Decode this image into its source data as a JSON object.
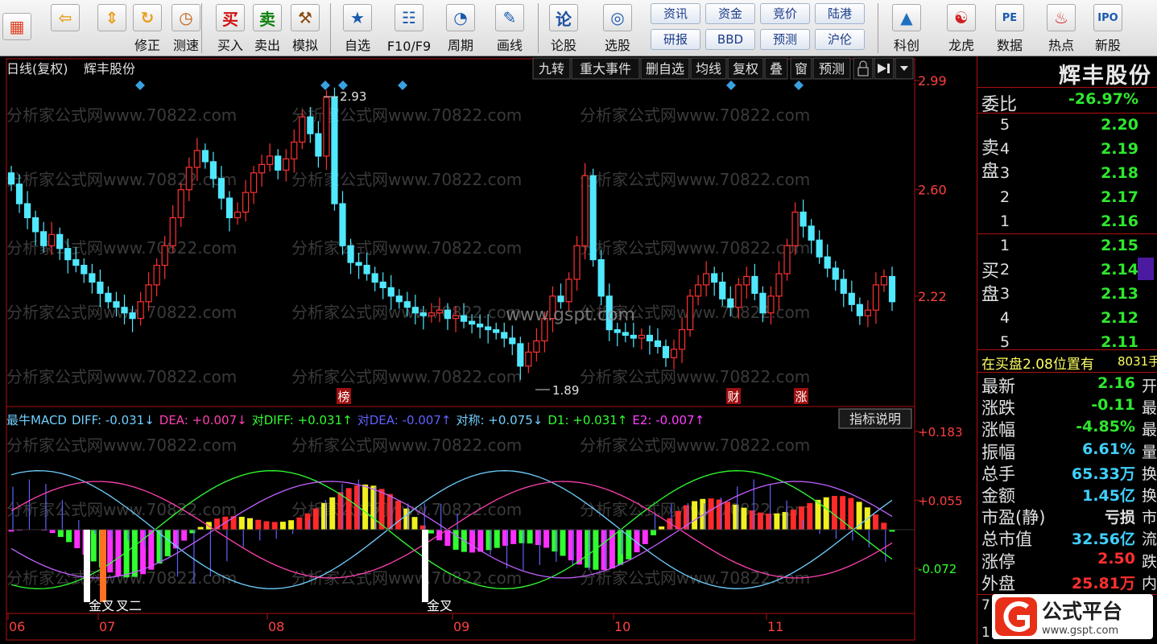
{
  "toolbar": {
    "buttons": [
      {
        "label": "",
        "icon": "app-grid-icon"
      },
      {
        "label": "",
        "icon": "back-arrow-icon"
      },
      {
        "label": "",
        "icon": "up-down-arrows-icon"
      },
      {
        "label": "修正",
        "icon": "refresh-icon"
      },
      {
        "label": "测速",
        "icon": "clock-icon"
      },
      {
        "label": "买入",
        "icon_text": "买",
        "icon_color": "#d01010"
      },
      {
        "label": "卖出",
        "icon_text": "卖",
        "icon_color": "#108010"
      },
      {
        "label": "模拟",
        "icon": "hammer-icon"
      },
      {
        "label": "自选",
        "icon": "star-icon"
      },
      {
        "label": "F10/F9",
        "icon": "f10-icon"
      },
      {
        "label": "周期",
        "icon": "period-icon"
      },
      {
        "label": "画线",
        "icon": "pen-icon"
      },
      {
        "label": "论股",
        "icon_text": "论",
        "icon_color": "#1a50a0"
      },
      {
        "label": "选股",
        "icon": "select-stock-icon"
      },
      {
        "label": "科创",
        "icon": "kechuang-icon"
      },
      {
        "label": "龙虎",
        "icon": "dragon-icon"
      },
      {
        "label": "数据",
        "icon": "pe-icon"
      },
      {
        "label": "热点",
        "icon": "hot-icon"
      },
      {
        "label": "新股",
        "icon": "ipo-icon"
      }
    ],
    "pills": [
      "资讯",
      "资金",
      "竞价",
      "陆港",
      "研报",
      "BBD",
      "预测",
      "沪伦"
    ]
  },
  "chart_header": {
    "period": "日线(复权)",
    "stock_name": "辉丰股份",
    "menu": [
      "九转",
      "重大事件",
      "删自选",
      "均线",
      "复权",
      "叠",
      "窗",
      "预测"
    ]
  },
  "watermark": "分析家公式网www.70822.com",
  "site_watermark": "www.gspt.com",
  "price_axis": {
    "labels": [
      "2.99",
      "2.60",
      "2.22"
    ]
  },
  "price_annotations": {
    "high": "2.93",
    "low": "1.89"
  },
  "event_marks": [
    "榜",
    "财",
    "涨"
  ],
  "macd": {
    "title": "最牛MACD",
    "fields": [
      {
        "text": "DIFF: -0.031↓",
        "color": "#70d0ff"
      },
      {
        "text": "DEA: +0.007↓",
        "color": "#ff40b0"
      },
      {
        "text": "对DIFF: +0.031↑",
        "color": "#30ff30"
      },
      {
        "text": "对DEA: -0.007↑",
        "color": "#6060ff"
      },
      {
        "text": "对称: +0.075↓",
        "color": "#70d0ff"
      },
      {
        "text": "D1: +0.031↑",
        "color": "#30ff30"
      },
      {
        "text": "E2: -0.007↑",
        "color": "#ff40ff"
      }
    ],
    "explain_button": "指标说明",
    "axis_labels": [
      "+0.183",
      "+0.055",
      "-0.072"
    ],
    "signals": [
      "金叉",
      "叉二",
      "金叉"
    ]
  },
  "time_axis": [
    "06",
    "07",
    "08",
    "09",
    "10",
    "11"
  ],
  "quote": {
    "name": "辉丰股份",
    "ratio_label": "委比",
    "ratio_value": "-26.97%",
    "sell_label": "卖盘",
    "buy_label": "买盘",
    "sell_levels": [
      {
        "level": "5",
        "price": "2.20"
      },
      {
        "level": "4",
        "price": "2.19"
      },
      {
        "level": "3",
        "price": "2.18"
      },
      {
        "level": "2",
        "price": "2.17"
      },
      {
        "level": "1",
        "price": "2.16"
      }
    ],
    "buy_levels": [
      {
        "level": "1",
        "price": "2.15"
      },
      {
        "level": "2",
        "price": "2.14"
      },
      {
        "level": "3",
        "price": "2.13"
      },
      {
        "level": "4",
        "price": "2.12"
      },
      {
        "level": "5",
        "price": "2.11"
      }
    ],
    "notice": "在买盘2.08位置有",
    "notice_volume": "8031手",
    "stats": [
      {
        "label": "最新",
        "value": "2.16",
        "color": "#2ee82e",
        "edge": "开"
      },
      {
        "label": "涨跌",
        "value": "-0.11",
        "color": "#2ee82e",
        "edge": "最"
      },
      {
        "label": "涨幅",
        "value": "-4.85%",
        "color": "#2ee82e",
        "edge": "最"
      },
      {
        "label": "振幅",
        "value": "6.61%",
        "color": "#40d0ff",
        "edge": "量"
      },
      {
        "label": "总手",
        "value": "65.33万",
        "color": "#40d0ff",
        "edge": "换"
      },
      {
        "label": "金额",
        "value": "1.45亿",
        "color": "#40d0ff",
        "edge": "换"
      },
      {
        "label": "市盈(静)",
        "value": "亏损",
        "color": "#e0e0e0",
        "edge": "市"
      },
      {
        "label": "总市值",
        "value": "32.56亿",
        "color": "#40d0ff",
        "edge": "流"
      },
      {
        "label": "涨停",
        "value": "2.50",
        "color": "#ff3030",
        "edge": "跌"
      },
      {
        "label": "外盘",
        "value": "25.81万",
        "color": "#ff3030",
        "edge": "内"
      }
    ],
    "footer_digit": "7",
    "footer_digit2": "1"
  },
  "logo": {
    "title": "公式平台",
    "url": "www.gspt.com"
  },
  "colors": {
    "up": "#ff3030",
    "down": "#50e8ff",
    "axis": "#b01010",
    "grid_text": "#ff4040"
  }
}
